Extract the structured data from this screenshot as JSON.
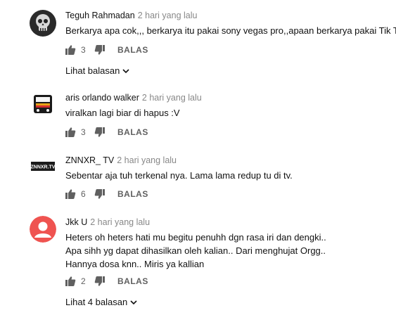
{
  "comments": [
    {
      "author": "Teguh Rahmadan",
      "time": "2 hari yang lalu",
      "lines": [
        "Berkarya apa cok,,, berkarya itu pakai sony vegas pro,,apaan berkarya pakai Tik Tik"
      ],
      "likes": "3",
      "reply_label": "BALAS",
      "view_replies": "Lihat balasan",
      "avatar_icon": "skull-avatar-icon"
    },
    {
      "author": "aris orlando walker",
      "time": "2 hari yang lalu",
      "lines": [
        "viralkan lagi biar di hapus :V"
      ],
      "likes": "3",
      "reply_label": "BALAS",
      "avatar_icon": "bus-avatar-icon"
    },
    {
      "author": "ZNNXR_ TV",
      "time": "2 hari yang lalu",
      "lines": [
        "Sebentar aja tuh terkenal nya. Lama lama redup tu di tv."
      ],
      "likes": "6",
      "reply_label": "BALAS",
      "avatar_icon": "channel-logo-avatar-icon",
      "avatar_text": "ZNNXR.TV"
    },
    {
      "author": "Jkk U",
      "time": "2 hari yang lalu",
      "lines": [
        "Heters oh heters  hati mu begitu penuhh dgn rasa iri dan dengki..",
        "Apa sihh yg dapat dihasilkan oleh kalian.. Dari menghujat Orgg..",
        "Hannya dosa  knn.. Miris ya kallian"
      ],
      "likes": "2",
      "reply_label": "BALAS",
      "view_replies": "Lihat 4 balasan",
      "avatar_icon": "default-user-avatar-icon"
    }
  ],
  "colors": {
    "text": "#111111",
    "meta": "#888888",
    "icon": "#606060",
    "default_avatar": "#ef5350"
  }
}
